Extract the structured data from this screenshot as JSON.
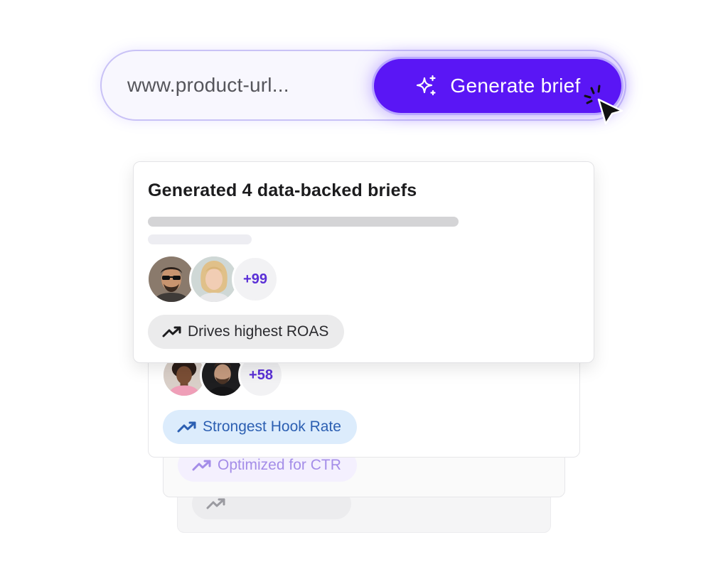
{
  "url_bar": {
    "url_text": "www.product-url...",
    "button_label": "Generate brief"
  },
  "main_card": {
    "title": "Generated 4 data-backed briefs",
    "avatar_count": "+99",
    "tag": "Drives highest ROAS"
  },
  "card_2": {
    "avatar_count": "+58",
    "tag": "Strongest Hook Rate"
  },
  "card_3": {
    "tag": "Optimized for CTR"
  },
  "icons": {
    "button": "sparkle-icon",
    "cursor": "cursor-click-icon",
    "tags": "trending-up-icon"
  },
  "colors": {
    "accent": "#5a16f5",
    "count_text": "#5a2fd6",
    "hook_tag_bg": "#dcecfc",
    "hook_tag_text": "#2c5fb2",
    "ctr_tag_text": "#a48de8"
  }
}
